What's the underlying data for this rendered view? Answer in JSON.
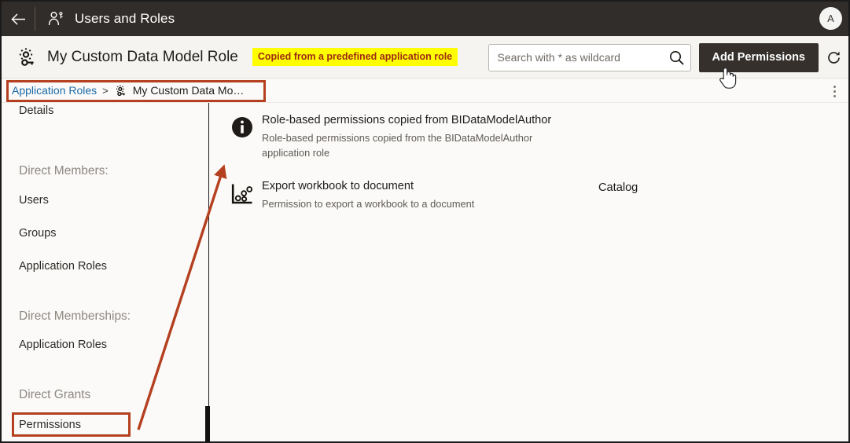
{
  "topbar": {
    "back_icon": "arrow-left-icon",
    "app_icon": "users-roles-icon",
    "title": "Users and Roles",
    "avatar_initial": "A"
  },
  "header": {
    "role_icon": "role-gear-icon",
    "role_name": "My Custom Data Model Role",
    "copied_badge": "Copied from a predefined application role",
    "search": {
      "placeholder": "Search with * as wildcard",
      "value": "",
      "icon": "search-icon"
    },
    "add_permissions_label": "Add Permissions",
    "refresh_icon": "refresh-icon"
  },
  "breadcrumb": {
    "root_label": "Application Roles",
    "separator": ">",
    "current_icon": "role-gear-icon",
    "current_label": "My Custom Data Mo…",
    "kebab_icon": "more-vertical-icon"
  },
  "sidebar": {
    "items": [
      {
        "kind": "item",
        "label": "Details",
        "name": "details"
      },
      {
        "kind": "group",
        "label": "Direct Members:",
        "name": "direct-members"
      },
      {
        "kind": "item",
        "label": "Users",
        "name": "users"
      },
      {
        "kind": "item",
        "label": "Groups",
        "name": "groups"
      },
      {
        "kind": "item",
        "label": "Application Roles",
        "name": "member-application-roles"
      },
      {
        "kind": "group",
        "label": "Direct Memberships:",
        "name": "direct-memberships"
      },
      {
        "kind": "item",
        "label": "Application Roles",
        "name": "membership-application-roles"
      },
      {
        "kind": "group",
        "label": "Direct Grants",
        "name": "direct-grants"
      },
      {
        "kind": "item",
        "label": "Permissions",
        "name": "permissions"
      }
    ]
  },
  "content": {
    "rows": [
      {
        "icon": "info-icon",
        "title": "Role-based permissions copied from BIDataModelAuthor",
        "subtitle": "Role-based permissions copied from the BIDataModelAuthor application role",
        "scope": ""
      },
      {
        "icon": "scatter-plot-icon",
        "title": "Export workbook to document",
        "subtitle": "Permission to export a workbook to a document",
        "scope": "Catalog"
      }
    ]
  },
  "annotations": {
    "highlight_color": "#b4401f",
    "badge_bg": "#ffff00",
    "badge_text_color": "#9e2a16",
    "arrow_from": "permissions-nav-item",
    "arrow_to": "permission-row-export-workbook",
    "cursor": "pointing-hand-cursor"
  }
}
